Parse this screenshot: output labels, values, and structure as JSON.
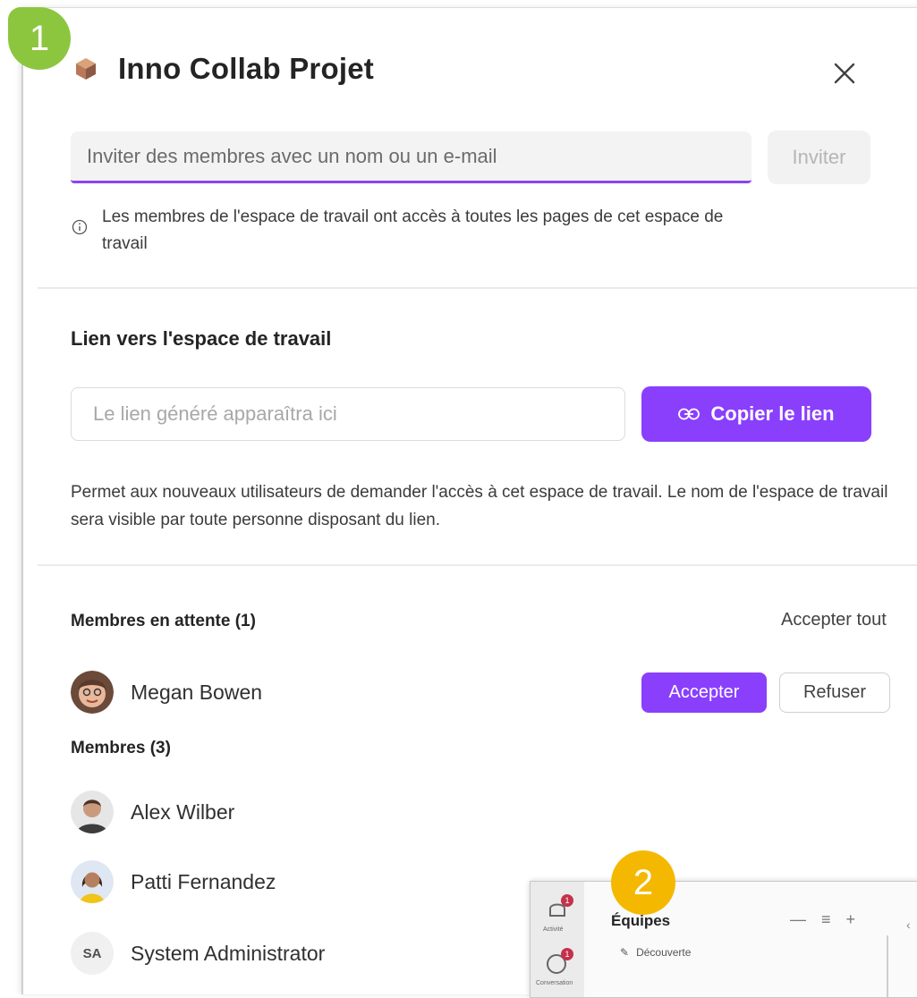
{
  "badges": {
    "step1": "1",
    "step2": "2"
  },
  "dialog": {
    "title": "Inno Collab Projet",
    "title_icon": "cube-icon",
    "close_icon": "close-icon"
  },
  "invite": {
    "placeholder": "Inviter des membres avec un nom ou un e-mail",
    "button_label": "Inviter",
    "info_text": "Les membres de l'espace de travail ont accès à toutes les pages de cet espace de travail"
  },
  "link_section": {
    "title": "Lien vers l'espace de travail",
    "placeholder": "Le lien généré apparaîtra ici",
    "copy_button_label": "Copier le lien",
    "description": "Permet aux nouveaux utilisateurs de demander l'accès à cet espace de travail. Le nom de l'espace de travail sera visible par toute personne disposant du lien."
  },
  "pending": {
    "title": "Membres en attente (1)",
    "accept_all_label": "Accepter tout",
    "members": [
      {
        "name": "Megan Bowen",
        "accept_label": "Accepter",
        "refuse_label": "Refuser"
      }
    ]
  },
  "members": {
    "title": "Membres (3)",
    "list": [
      {
        "name": "Alex Wilber"
      },
      {
        "name": "Patti Fernandez"
      },
      {
        "name": "System Administrator",
        "initials": "SA"
      }
    ]
  },
  "inset": {
    "title": "Équipes",
    "nav_item": "Découverte",
    "tools": "— ≡ +",
    "rail": [
      {
        "label": "Activité",
        "count": "1"
      },
      {
        "label": "Conversation",
        "count": "1"
      }
    ]
  },
  "colors": {
    "accent": "#8a3ffc",
    "badge_green": "#8cc63f",
    "badge_yellow": "#f5b800"
  }
}
